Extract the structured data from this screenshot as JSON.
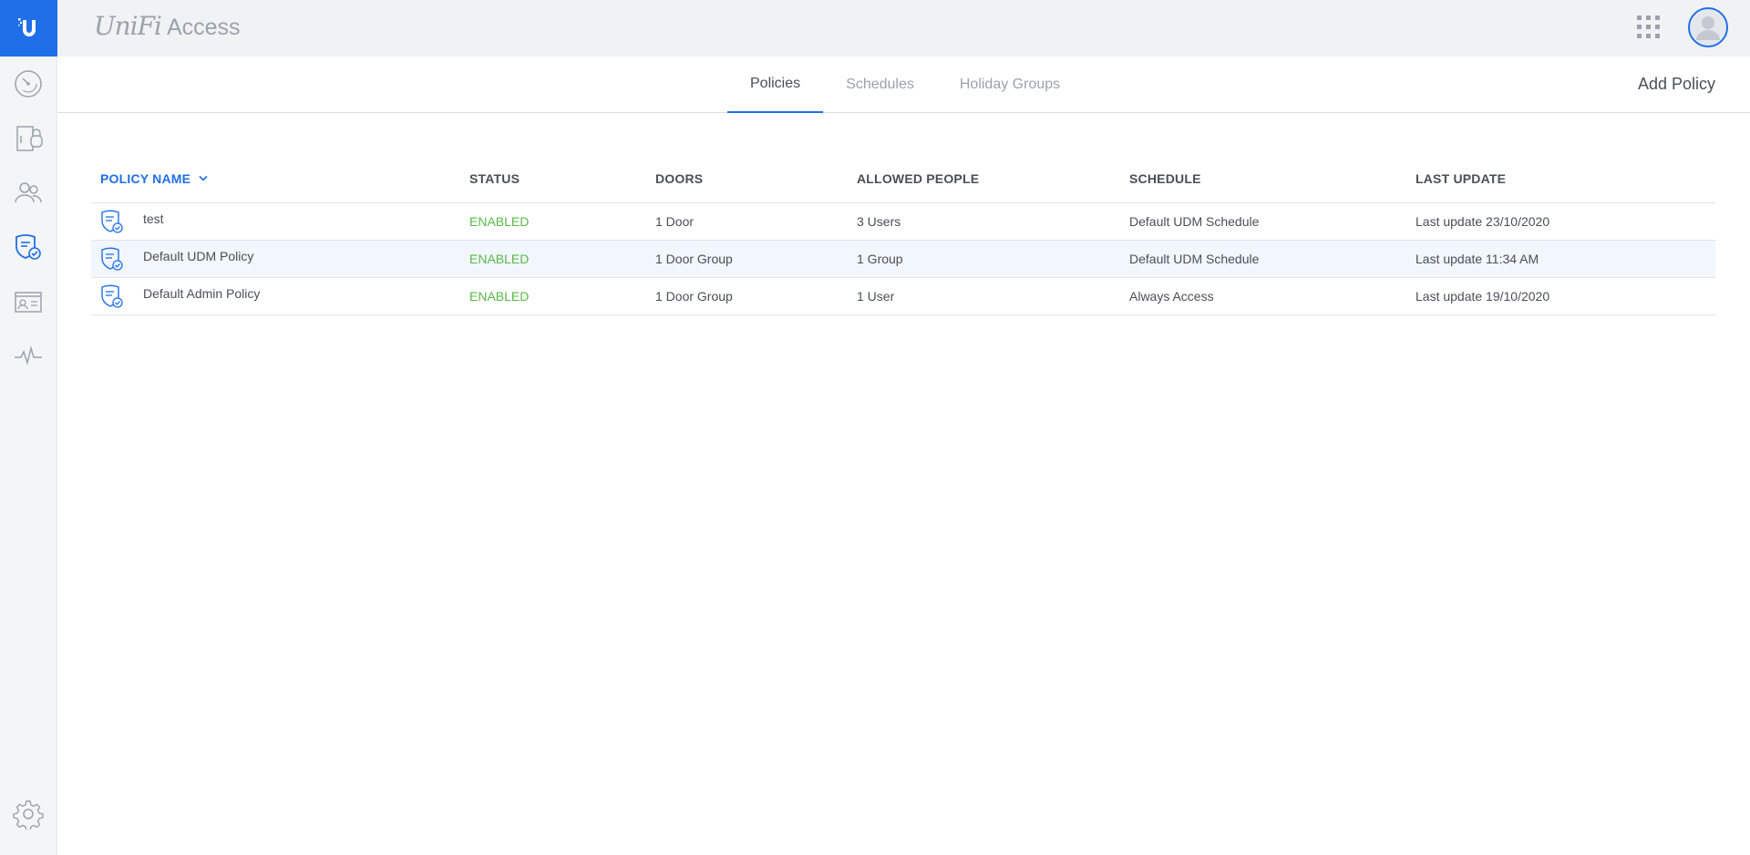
{
  "app": {
    "brand_unifi": "UniFi",
    "brand_access": "Access",
    "accent_color": "#1f6fe8",
    "enabled_color": "#58b947"
  },
  "sidebar": {
    "items": [
      {
        "name": "dashboard",
        "icon": "gauge-icon"
      },
      {
        "name": "doors",
        "icon": "door-icon"
      },
      {
        "name": "users",
        "icon": "users-icon"
      },
      {
        "name": "policies",
        "icon": "policy-shield-icon",
        "active": true
      },
      {
        "name": "visitors",
        "icon": "id-card-icon"
      },
      {
        "name": "activity",
        "icon": "pulse-icon"
      }
    ],
    "settings_icon": "gear-icon"
  },
  "tabs": {
    "items": [
      {
        "label": "Policies",
        "active": true
      },
      {
        "label": "Schedules",
        "active": false
      },
      {
        "label": "Holiday Groups",
        "active": false
      }
    ],
    "add_label": "Add Policy"
  },
  "table": {
    "columns": [
      "POLICY NAME",
      "STATUS",
      "DOORS",
      "ALLOWED PEOPLE",
      "SCHEDULE",
      "LAST UPDATE"
    ],
    "rows": [
      {
        "name": "test",
        "status": "ENABLED",
        "doors": "1 Door",
        "people": "3 Users",
        "schedule": "Default UDM Schedule",
        "updated": "Last update 23/10/2020"
      },
      {
        "name": "Default UDM Policy",
        "status": "ENABLED",
        "doors": "1 Door Group",
        "people": "1 Group",
        "schedule": "Default UDM Schedule",
        "updated": "Last update 11:34 AM"
      },
      {
        "name": "Default Admin Policy",
        "status": "ENABLED",
        "doors": "1 Door Group",
        "people": "1 User",
        "schedule": "Always Access",
        "updated": "Last update 19/10/2020"
      }
    ]
  }
}
